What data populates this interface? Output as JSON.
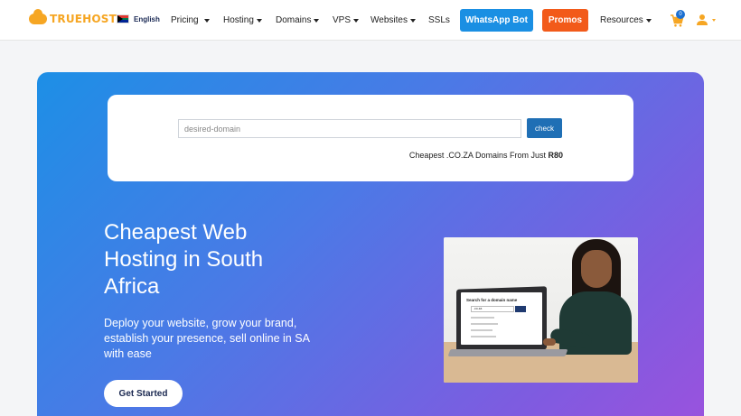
{
  "brand": {
    "name": "TRUEHOST",
    "color": "#f6a623"
  },
  "language": {
    "label": "English",
    "flag": "south-africa-flag"
  },
  "nav": {
    "items": [
      {
        "label": "Pricing",
        "has_dropdown": true
      },
      {
        "label": "Hosting",
        "has_dropdown": true
      },
      {
        "label": "Domains",
        "has_dropdown": true
      },
      {
        "label": "VPS",
        "has_dropdown": true
      },
      {
        "label": "Websites",
        "has_dropdown": true
      },
      {
        "label": "SSLs",
        "has_dropdown": false
      }
    ],
    "whatsapp_label": "WhatsApp Bot",
    "promos_label": "Promos",
    "resources_label": "Resources",
    "cart_count": "0"
  },
  "colors": {
    "accent_blue": "#1a8fe3",
    "promo_orange": "#f25a1a",
    "check_button": "#1f6fb5",
    "hero_gradient_start": "#1d8fe6",
    "hero_gradient_end": "#9b52dd"
  },
  "search": {
    "placeholder": "desired-domain",
    "button_label": "check",
    "promo_text": "Cheapest .CO.ZA Domains From Just",
    "promo_price": "R80"
  },
  "hero": {
    "title": "Cheapest Web Hosting in South Africa",
    "subtitle": "Deploy your website, grow your brand, establish your presence, sell online in SA with ease",
    "cta_label": "Get Started"
  },
  "photo": {
    "screen_title": "Search for a domain name",
    "screen_input": ".co.za"
  }
}
